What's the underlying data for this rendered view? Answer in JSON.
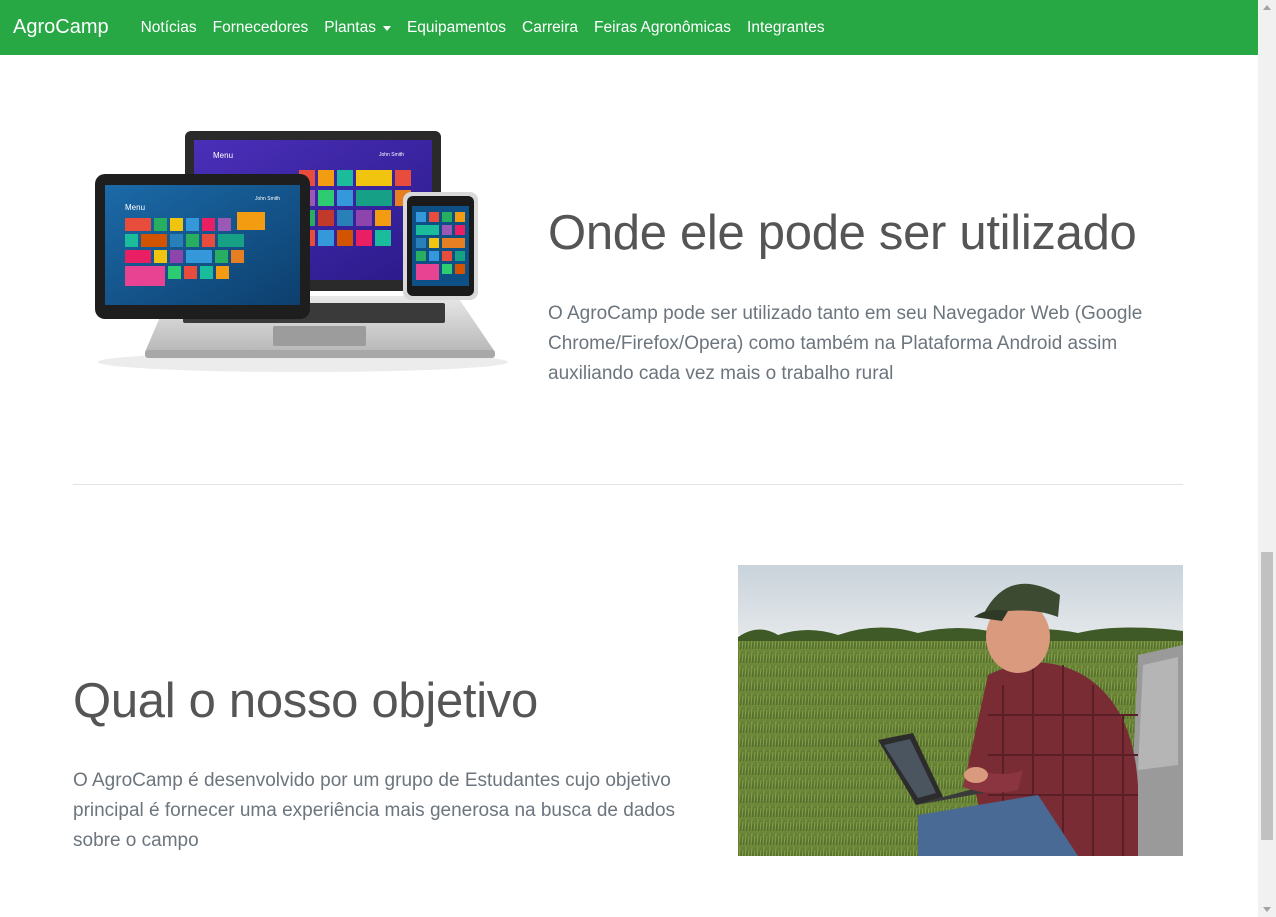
{
  "navbar": {
    "brand": "AgroCamp",
    "items": [
      {
        "label": "Notícias"
      },
      {
        "label": "Fornecedores"
      },
      {
        "label": "Plantas",
        "dropdown": true
      },
      {
        "label": "Equipamentos"
      },
      {
        "label": "Carreira"
      },
      {
        "label": "Feiras Agronômicas"
      },
      {
        "label": "Integrantes"
      }
    ],
    "color": "#28a745"
  },
  "section_usage": {
    "title": "Onde ele pode ser utilizado",
    "text": "O AgroCamp pode ser utilizado tanto em seu Navegador Web (Google Chrome/Firefox/Opera) como também na Plataforma Android assim auxiliando cada vez mais o trabalho rural",
    "image_icon": "devices-image",
    "devices": {
      "laptop_menu": "Menu",
      "laptop_user": "John Smith",
      "tablet_menu": "Menu",
      "tablet_user": "John Smith"
    }
  },
  "section_goal": {
    "title": "Qual o nosso objetivo",
    "text": "O AgroCamp é desenvolvido por um grupo de Estudantes cujo objetivo principal é fornecer uma experiência mais generosa na busca de dados sobre o campo",
    "image_icon": "farmer-image"
  }
}
